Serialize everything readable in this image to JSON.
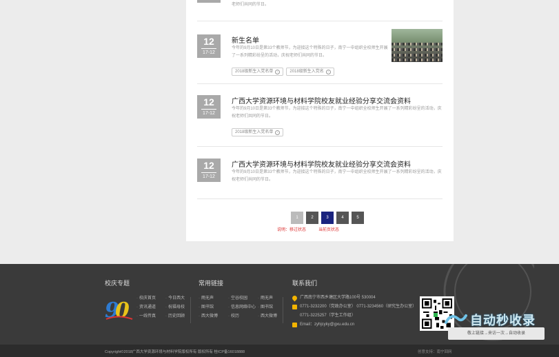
{
  "items": [
    {
      "day": "12",
      "month": "17-12",
      "title": "",
      "desc": "老师们共同的节日。",
      "tags": []
    },
    {
      "day": "12",
      "month": "17-12",
      "title": "新生名单",
      "desc": "今年的9月10日是第33个教师节，为迎接这个特殊的日子，南宁一中组织全校师生开展了一系列精彩纷呈的活动，庆祝老师们共同的节日。",
      "tags": [
        "2018级新生入党名单",
        "2018级新生入党名"
      ]
    },
    {
      "day": "12",
      "month": "17-12",
      "title": "广西大学资源环境与材料学院校友就业经验分享交流会资料",
      "desc": "今年的9月10日是第33个教师节，为迎接这个特殊的日子，南宁一中组织全校师生开展了一系列精彩纷呈的活动，庆祝老师们共同的节日。",
      "tags": [
        "2018级新生入党名单"
      ]
    },
    {
      "day": "12",
      "month": "17-12",
      "title": "广西大学资源环境与材料学院校友就业经验分享交流会资料",
      "desc": "今年的9月10日是第33个教师节，为迎接这个特殊的日子，南宁一中组织全校师生开展了一系列精彩纷呈的活动，庆祝老师们共同的节日。",
      "tags": []
    }
  ],
  "pagination": {
    "pages": [
      "1",
      "2",
      "3",
      "4",
      "5"
    ],
    "current": "3",
    "legend_hover": "说明：移过状态",
    "legend_current": "当前页状态"
  },
  "footer": {
    "col1_title": "校庆专题",
    "col1_links": [
      "校庆首页",
      "资讯通道",
      "一线传真",
      "今日西大",
      "祝福母校",
      "历史回顾"
    ],
    "col2_title": "常用链接",
    "col2_links": [
      "雨无声",
      "图书馆",
      "西大微博",
      "空谷校园",
      "信息网络中心",
      "校历",
      "雨无声",
      "图书馆",
      "西大微博"
    ],
    "col3_title": "联系我们",
    "address": "广西南宁市西乡塘区大学路100号  530004",
    "phone1": "0771-3232200（党政办公室） 0771-3234560（研究生办公室）",
    "phone2": "0771-3225257（学生工作组）",
    "email": "Email：zyhjcyky@gxu.edu.cn",
    "copyright": "Copyright©2018广西大学资源环境与材料学院版权所有 版权所有 桂ICP备16018888",
    "credit": "创意支持：南宁回网"
  },
  "brand": {
    "name": "自动秒收录",
    "slogan": "敬上链接→来访一次→自动收录"
  },
  "colors": {
    "accent": "#1a237e",
    "footer_bg": "#3a3a3a",
    "icon": "#f3b400"
  }
}
